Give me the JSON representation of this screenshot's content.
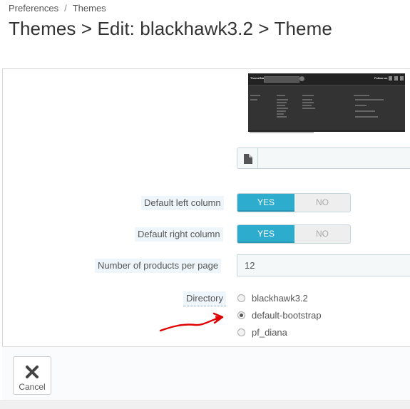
{
  "breadcrumb": {
    "items": [
      "Preferences",
      "Themes"
    ],
    "separator": "/"
  },
  "page_title": "Themes > Edit: blackhawk3.2 > Theme",
  "preview": {
    "logo_text": "ThemeStar",
    "follow_text": "Follow us"
  },
  "form": {
    "default_left_column": {
      "label": "Default left column",
      "yes_label": "YES",
      "no_label": "NO",
      "selected": "YES"
    },
    "default_right_column": {
      "label": "Default right column",
      "yes_label": "YES",
      "no_label": "NO",
      "selected": "YES"
    },
    "products_per_page": {
      "label": "Number of products per page",
      "value": "12"
    },
    "directory": {
      "label": "Directory",
      "options": [
        {
          "label": "blackhawk3.2",
          "checked": false
        },
        {
          "label": "default-bootstrap",
          "checked": true
        },
        {
          "label": "pf_diana",
          "checked": false
        }
      ]
    }
  },
  "footer": {
    "cancel_label": "Cancel"
  },
  "colors": {
    "toggle_on": "#2eacce",
    "label_bg": "#eef6fb",
    "annotation_arrow": "#e00000"
  },
  "icons": [
    "file-icon",
    "close-icon",
    "red-arrow-annotation"
  ]
}
